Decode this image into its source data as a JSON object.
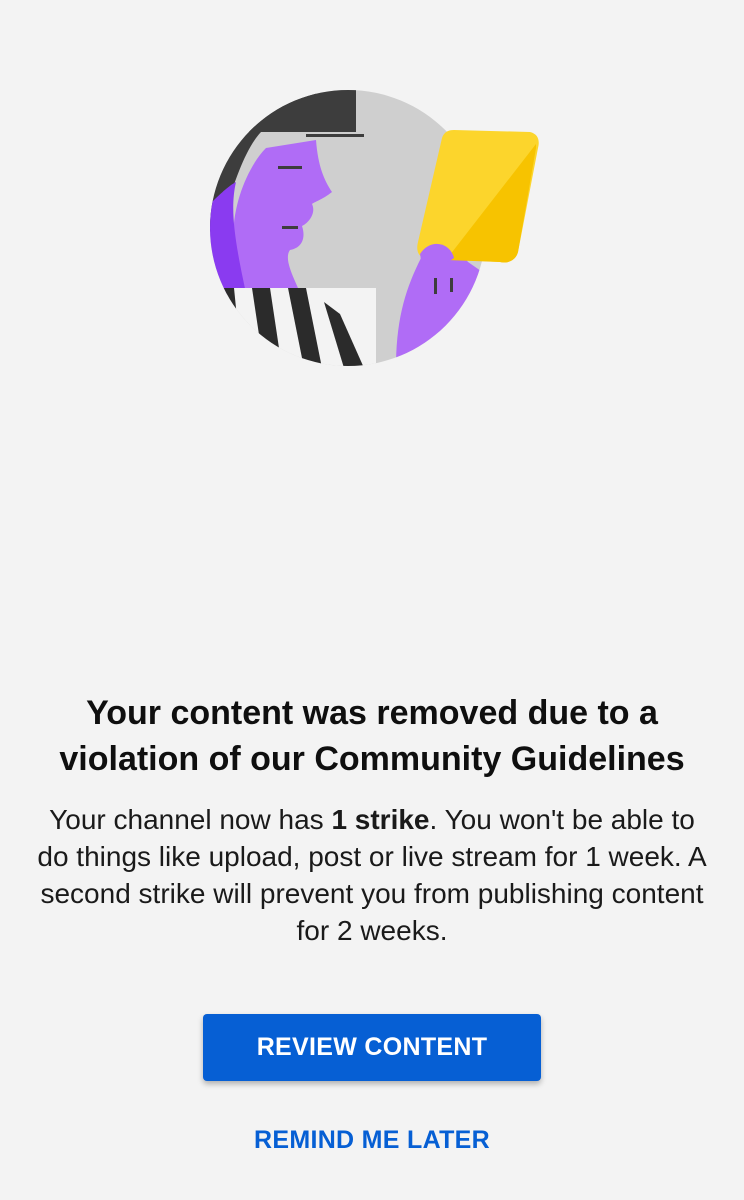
{
  "dialog": {
    "title": "Your content was removed due to a violation of our Community Guidelines",
    "body_before": "Your channel now has ",
    "body_strong": "1 strike",
    "body_after": ". You won't be able to do things like upload, post or live stream for 1 week. A second strike will prevent you from publishing content for 2 weeks.",
    "primary_button": "REVIEW CONTENT",
    "secondary_button": "REMIND ME LATER"
  },
  "colors": {
    "background": "#f3f3f3",
    "accent": "#065fd4",
    "illustration_purple": "#b06cf6",
    "illustration_card": "#fcd52c"
  },
  "illustration": {
    "icon": "referee-yellow-card-illustration"
  }
}
